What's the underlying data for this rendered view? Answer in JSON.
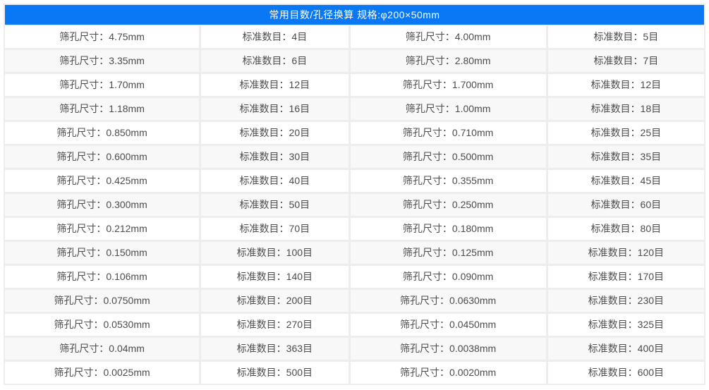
{
  "header": {
    "title": "常用目数/孔径换算 规格:φ200×50mm"
  },
  "colors": {
    "accent_blue": "#0a78f5",
    "header_text": "#ffffff",
    "row_bg": "#ffffff",
    "row_alt_bg": "#f8f8f8",
    "divider": "#ededed",
    "cell_text": "#4c4c4c"
  },
  "table": {
    "cell_kinds": [
      "sieve-size-cell",
      "mesh-count-cell",
      "sieve-size-cell",
      "mesh-count-cell"
    ],
    "rows": [
      [
        "筛孔尺寸：4.75mm",
        "标准数目：4目",
        "筛孔尺寸：4.00mm",
        "标准数目：5目"
      ],
      [
        "筛孔尺寸：3.35mm",
        "标准数目：6目",
        "筛孔尺寸：2.80mm",
        "标准数目：7目"
      ],
      [
        "筛孔尺寸：1.70mm",
        "标准数目：12目",
        "筛孔尺寸：1.700mm",
        "标准数目：12目"
      ],
      [
        "筛孔尺寸：1.18mm",
        "标准数目：16目",
        "筛孔尺寸：1.00mm",
        "标准数目：18目"
      ],
      [
        "筛孔尺寸：0.850mm",
        "标准数目：20目",
        "筛孔尺寸：0.710mm",
        "标准数目：25目"
      ],
      [
        "筛孔尺寸：0.600mm",
        "标准数目：30目",
        "筛孔尺寸：0.500mm",
        "标准数目：35目"
      ],
      [
        "筛孔尺寸：0.425mm",
        "标准数目：40目",
        "筛孔尺寸：0.355mm",
        "标准数目：45目"
      ],
      [
        "筛孔尺寸：0.300mm",
        "标准数目：50目",
        "筛孔尺寸：0.250mm",
        "标准数目：60目"
      ],
      [
        "筛孔尺寸：0.212mm",
        "标准数目：70目",
        "筛孔尺寸：0.180mm",
        "标准数目：80目"
      ],
      [
        "筛孔尺寸：0.150mm",
        "标准数目：100目",
        "筛孔尺寸：0.125mm",
        "标准数目：120目"
      ],
      [
        "筛孔尺寸：0.106mm",
        "标准数目：140目",
        "筛孔尺寸：0.090mm",
        "标准数目：170目"
      ],
      [
        "筛孔尺寸：0.0750mm",
        "标准数目：200目",
        "筛孔尺寸：0.0630mm",
        "标准数目：230目"
      ],
      [
        "筛孔尺寸：0.0530mm",
        "标准数目：270目",
        "筛孔尺寸：0.0450mm",
        "标准数目：325目"
      ],
      [
        "筛孔尺寸：0.04mm",
        "标准数目：363目",
        "筛孔尺寸：0.0038mm",
        "标准数目：400目"
      ],
      [
        "筛孔尺寸：0.0025mm",
        "标准数目：500目",
        "筛孔尺寸：0.0020mm",
        "标准数目：600目"
      ]
    ]
  }
}
